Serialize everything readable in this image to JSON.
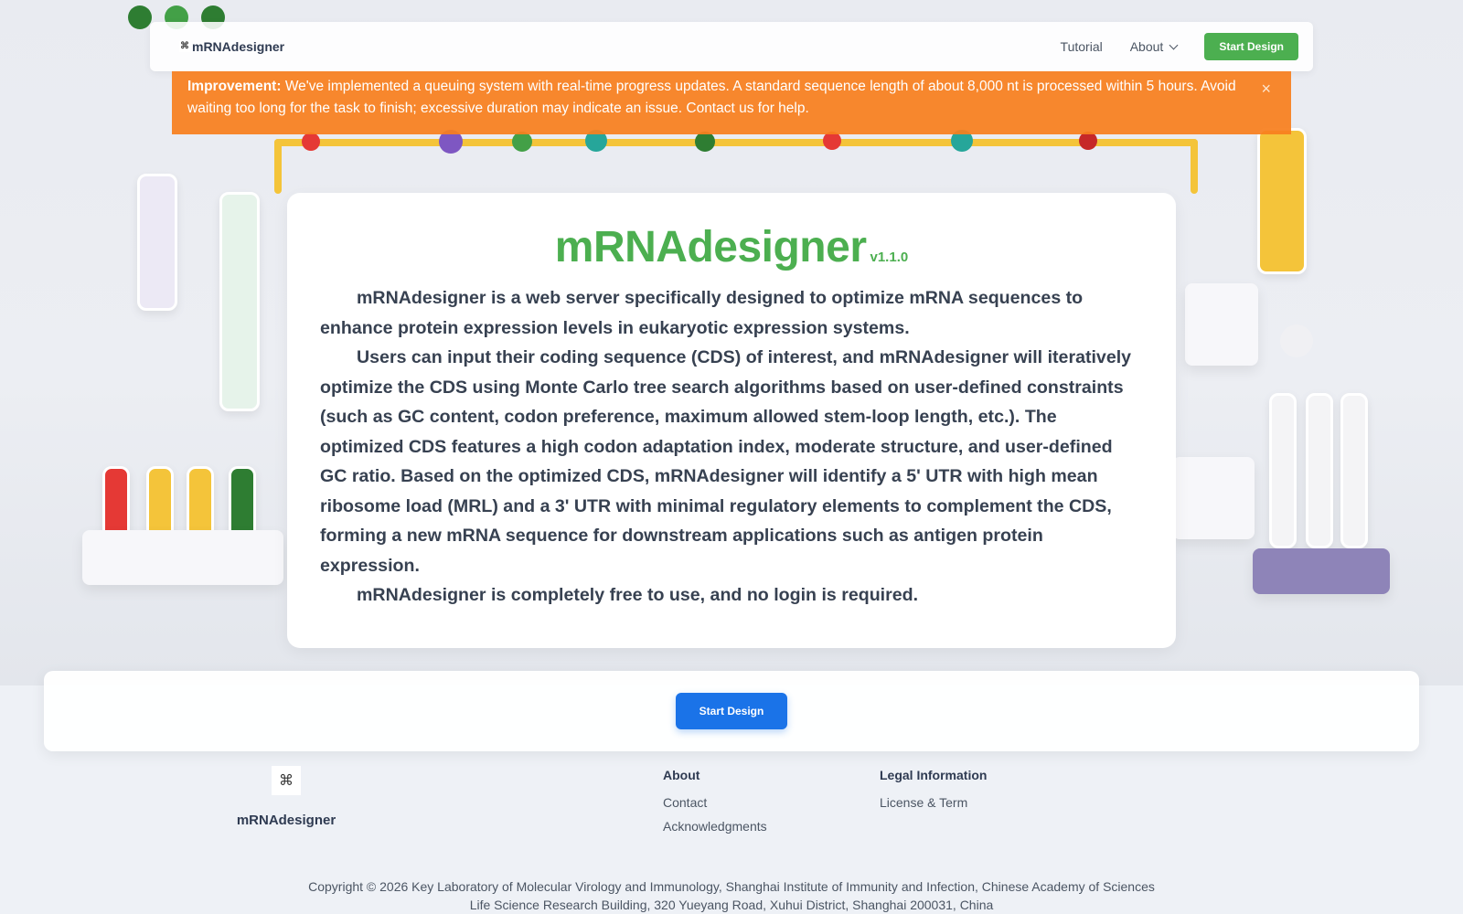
{
  "navbar": {
    "brand": "mRNAdesigner",
    "links": {
      "tutorial": "Tutorial",
      "about": "About"
    },
    "start_button": "Start Design"
  },
  "alert": {
    "label": "Improvement:",
    "message": "We've implemented a queuing system with real-time progress updates. A standard sequence length of about 8,000 nt is processed within 5 hours. Avoid waiting too long for the task to finish; excessive duration may indicate an issue. Contact us for help.",
    "close": "×"
  },
  "main": {
    "title": "mRNAdesigner",
    "version": "v1.1.0",
    "paragraphs": [
      "mRNAdesigner is a web server specifically designed to optimize mRNA sequences to enhance protein expression levels in eukaryotic expression systems.",
      "Users can input their coding sequence (CDS) of interest, and mRNAdesigner will iteratively optimize the CDS using Monte Carlo tree search algorithms based on user-defined constraints (such as GC content, codon preference, maximum allowed stem-loop length, etc.). The optimized CDS features a high codon adaptation index, moderate structure, and user-defined GC ratio. Based on the optimized CDS, mRNAdesigner will identify a 5' UTR with high mean ribosome load (MRL) and a 3' UTR with minimal regulatory elements to complement the CDS, forming a new mRNA sequence for downstream applications such as antigen protein expression.",
      "mRNAdesigner is completely free to use, and no login is required."
    ]
  },
  "cta": {
    "button": "Start Design"
  },
  "footer": {
    "brand": "mRNAdesigner",
    "about": {
      "heading": "About",
      "links": [
        "Contact",
        "Acknowledgments"
      ]
    },
    "legal": {
      "heading": "Legal Information",
      "links": [
        "License & Term"
      ]
    },
    "copyright": "Copyright © 2026 Key Laboratory of Molecular Virology and Immunology, Shanghai Institute of Immunity and Infection, Chinese Academy of Sciences",
    "address": "Life Science Research Building, 320 Yueyang Road, Xuhui District, Shanghai 200031, China"
  },
  "colors": {
    "accent_green": "#4caf50",
    "primary_blue": "#1a73e8",
    "alert_orange": "#f77f1e"
  },
  "icons": {
    "brand": "dna-icon",
    "alert_close": "close-icon",
    "about_dropdown": "chevron-down-icon"
  }
}
